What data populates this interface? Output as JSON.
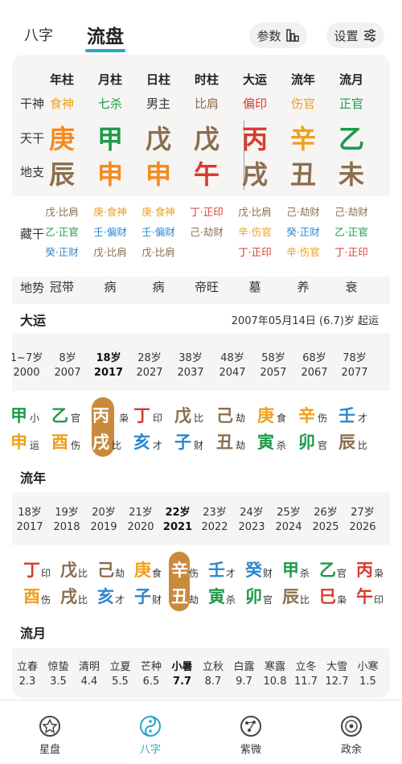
{
  "tabs": {
    "bazi": "八字",
    "liupan": "流盘"
  },
  "pills": {
    "params": "参数",
    "settings": "设置"
  },
  "colors": {
    "wood": "#1e9a48",
    "fire": "#d93a2e",
    "earth": "#8b6f4e",
    "metal": "#f0a018",
    "water": "#2a86d0",
    "accent": "#c98a3c"
  },
  "columns": [
    "年柱",
    "月柱",
    "日柱",
    "时柱",
    "大运",
    "流年",
    "流月"
  ],
  "row_labels": {
    "shishen": "干神",
    "tiangan": "天干",
    "dizhi": "地支",
    "canggan": "藏干",
    "dishi": "地势"
  },
  "shishen": [
    {
      "t": "食神",
      "c": "#f0a018"
    },
    {
      "t": "七杀",
      "c": "#1e9a48"
    },
    {
      "t": "男主",
      "c": "#333"
    },
    {
      "t": "比肩",
      "c": "#8b6f4e"
    },
    {
      "t": "偏印",
      "c": "#d93a2e"
    },
    {
      "t": "伤官",
      "c": "#f0a018"
    },
    {
      "t": "正官",
      "c": "#1e9a48"
    }
  ],
  "tiangan": [
    {
      "t": "庚",
      "c": "#f58a1f"
    },
    {
      "t": "甲",
      "c": "#1e9a48"
    },
    {
      "t": "戊",
      "c": "#8b6f4e"
    },
    {
      "t": "戊",
      "c": "#8b6f4e"
    },
    {
      "t": "丙",
      "c": "#d93a2e"
    },
    {
      "t": "辛",
      "c": "#f0a018"
    },
    {
      "t": "乙",
      "c": "#1e9a48"
    }
  ],
  "dizhi": [
    {
      "t": "辰",
      "c": "#8b6f4e"
    },
    {
      "t": "申",
      "c": "#f58a1f"
    },
    {
      "t": "申",
      "c": "#f58a1f"
    },
    {
      "t": "午",
      "c": "#d93a2e"
    },
    {
      "t": "戌",
      "c": "#8b6f4e"
    },
    {
      "t": "丑",
      "c": "#8b6f4e"
    },
    {
      "t": "未",
      "c": "#8b6f4e"
    }
  ],
  "canggan": [
    [
      {
        "t": "戊·比肩",
        "c": "#8b6f4e"
      },
      {
        "t": "乙·正官",
        "c": "#1e9a48"
      },
      {
        "t": "癸·正财",
        "c": "#2a86d0"
      }
    ],
    [
      {
        "t": "庚·食神",
        "c": "#f0a018"
      },
      {
        "t": "壬·偏财",
        "c": "#2a86d0"
      },
      {
        "t": "戊·比肩",
        "c": "#8b6f4e"
      }
    ],
    [
      {
        "t": "庚·食神",
        "c": "#f0a018"
      },
      {
        "t": "壬·偏财",
        "c": "#2a86d0"
      },
      {
        "t": "戊·比肩",
        "c": "#8b6f4e"
      }
    ],
    [
      {
        "t": "丁·正印",
        "c": "#d93a2e"
      },
      {
        "t": "己·劫财",
        "c": "#8b6f4e"
      }
    ],
    [
      {
        "t": "戊·比肩",
        "c": "#8b6f4e"
      },
      {
        "t": "辛·伤官",
        "c": "#f0a018"
      },
      {
        "t": "丁·正印",
        "c": "#d93a2e"
      }
    ],
    [
      {
        "t": "己·劫财",
        "c": "#8b6f4e"
      },
      {
        "t": "癸·正财",
        "c": "#2a86d0"
      },
      {
        "t": "辛·伤官",
        "c": "#f0a018"
      }
    ],
    [
      {
        "t": "己·劫财",
        "c": "#8b6f4e"
      },
      {
        "t": "乙·正官",
        "c": "#1e9a48"
      },
      {
        "t": "丁·正印",
        "c": "#d93a2e"
      }
    ]
  ],
  "dishi": [
    "冠带",
    "病",
    "病",
    "帝旺",
    "墓",
    "养",
    "衰"
  ],
  "dayun": {
    "title": "大运",
    "start": "2007年05月14日 (6.7)岁 起运",
    "ages": [
      "1~7岁",
      "8岁",
      "18岁",
      "28岁",
      "38岁",
      "48岁",
      "58岁",
      "68岁",
      "78岁"
    ],
    "years": [
      "2000",
      "2007",
      "2017",
      "2027",
      "2037",
      "2047",
      "2057",
      "2067",
      "2077"
    ],
    "gan": [
      {
        "t": "甲",
        "s": "小",
        "c": "#1e9a48"
      },
      {
        "t": "乙",
        "s": "官",
        "c": "#1e9a48"
      },
      {
        "t": "丙",
        "s": "枭",
        "c": "#d93a2e"
      },
      {
        "t": "丁",
        "s": "印",
        "c": "#d93a2e"
      },
      {
        "t": "戊",
        "s": "比",
        "c": "#8b6f4e"
      },
      {
        "t": "己",
        "s": "劫",
        "c": "#8b6f4e"
      },
      {
        "t": "庚",
        "s": "食",
        "c": "#f0a018"
      },
      {
        "t": "辛",
        "s": "伤",
        "c": "#f0a018"
      },
      {
        "t": "壬",
        "s": "才",
        "c": "#2a86d0"
      }
    ],
    "zhi": [
      {
        "t": "申",
        "s": "运",
        "c": "#f0a018"
      },
      {
        "t": "酉",
        "s": "伤",
        "c": "#f0a018"
      },
      {
        "t": "戌",
        "s": "比",
        "c": "#8b6f4e"
      },
      {
        "t": "亥",
        "s": "才",
        "c": "#2a86d0"
      },
      {
        "t": "子",
        "s": "财",
        "c": "#2a86d0"
      },
      {
        "t": "丑",
        "s": "劫",
        "c": "#8b6f4e"
      },
      {
        "t": "寅",
        "s": "杀",
        "c": "#1e9a48"
      },
      {
        "t": "卯",
        "s": "官",
        "c": "#1e9a48"
      },
      {
        "t": "辰",
        "s": "比",
        "c": "#8b6f4e"
      }
    ],
    "selected": 2
  },
  "liunian": {
    "title": "流年",
    "ages": [
      "18岁",
      "19岁",
      "20岁",
      "21岁",
      "22岁",
      "23岁",
      "24岁",
      "25岁",
      "26岁",
      "27岁"
    ],
    "years": [
      "2017",
      "2018",
      "2019",
      "2020",
      "2021",
      "2022",
      "2023",
      "2024",
      "2025",
      "2026"
    ],
    "gan": [
      {
        "t": "丁",
        "s": "印",
        "c": "#d93a2e"
      },
      {
        "t": "戊",
        "s": "比",
        "c": "#8b6f4e"
      },
      {
        "t": "己",
        "s": "劫",
        "c": "#8b6f4e"
      },
      {
        "t": "庚",
        "s": "食",
        "c": "#f0a018"
      },
      {
        "t": "辛",
        "s": "伤",
        "c": "#f0a018"
      },
      {
        "t": "壬",
        "s": "才",
        "c": "#2a86d0"
      },
      {
        "t": "癸",
        "s": "财",
        "c": "#2a86d0"
      },
      {
        "t": "甲",
        "s": "杀",
        "c": "#1e9a48"
      },
      {
        "t": "乙",
        "s": "官",
        "c": "#1e9a48"
      },
      {
        "t": "丙",
        "s": "枭",
        "c": "#d93a2e"
      }
    ],
    "zhi": [
      {
        "t": "酉",
        "s": "伤",
        "c": "#f0a018"
      },
      {
        "t": "戌",
        "s": "比",
        "c": "#8b6f4e"
      },
      {
        "t": "亥",
        "s": "才",
        "c": "#2a86d0"
      },
      {
        "t": "子",
        "s": "财",
        "c": "#2a86d0"
      },
      {
        "t": "丑",
        "s": "劫",
        "c": "#8b6f4e"
      },
      {
        "t": "寅",
        "s": "杀",
        "c": "#1e9a48"
      },
      {
        "t": "卯",
        "s": "官",
        "c": "#1e9a48"
      },
      {
        "t": "辰",
        "s": "比",
        "c": "#8b6f4e"
      },
      {
        "t": "巳",
        "s": "枭",
        "c": "#d93a2e"
      },
      {
        "t": "午",
        "s": "印",
        "c": "#d93a2e"
      }
    ],
    "selected": 4
  },
  "liuyue": {
    "title": "流月",
    "terms": [
      "立春",
      "惊蛰",
      "清明",
      "立夏",
      "芒种",
      "小暑",
      "立秋",
      "白露",
      "寒露",
      "立冬",
      "大雪",
      "小寒"
    ],
    "dates": [
      "2.3",
      "3.5",
      "4.4",
      "5.5",
      "6.5",
      "7.7",
      "8.7",
      "9.7",
      "10.8",
      "11.7",
      "12.7",
      "1.5"
    ],
    "selected": 5
  },
  "nav": [
    "星盘",
    "八字",
    "紫微",
    "政余"
  ]
}
